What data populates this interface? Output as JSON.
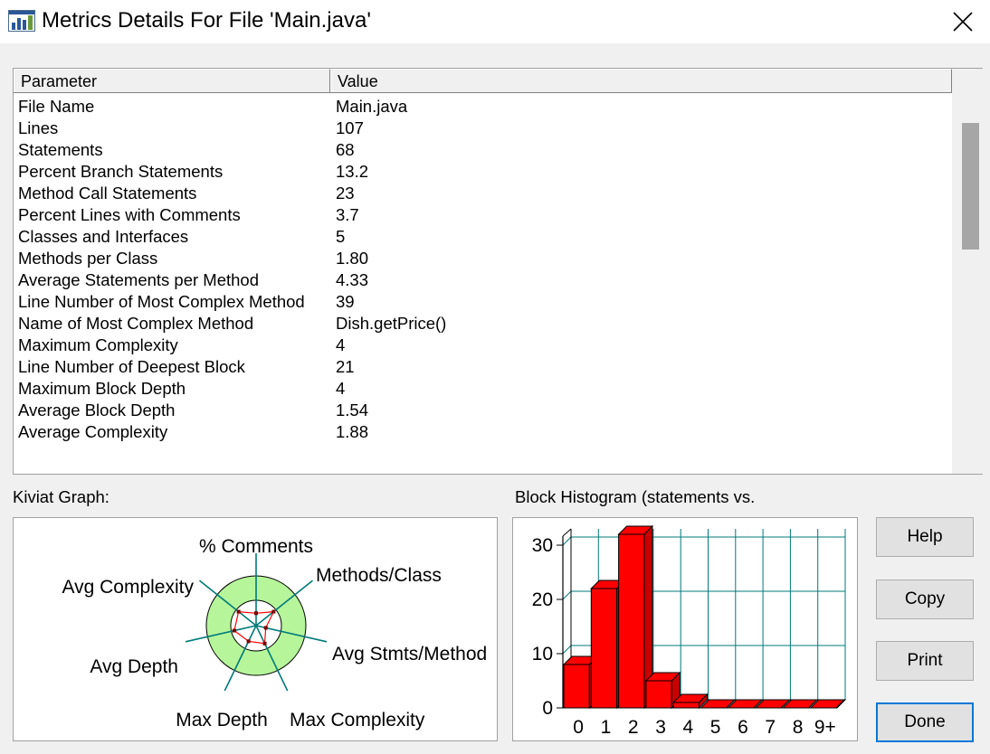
{
  "window": {
    "title": "Metrics Details For File 'Main.java'"
  },
  "table": {
    "headers": {
      "parameter": "Parameter",
      "value": "Value"
    },
    "rows": [
      {
        "param": "File Name",
        "value": "Main.java"
      },
      {
        "param": "Lines",
        "value": "107"
      },
      {
        "param": "Statements",
        "value": "68"
      },
      {
        "param": "Percent Branch Statements",
        "value": "13.2"
      },
      {
        "param": "Method Call Statements",
        "value": "23"
      },
      {
        "param": "Percent Lines with Comments",
        "value": "3.7"
      },
      {
        "param": "Classes and Interfaces",
        "value": "5"
      },
      {
        "param": "Methods per Class",
        "value": "1.80"
      },
      {
        "param": "Average Statements per Method",
        "value": "4.33"
      },
      {
        "param": "Line Number of Most Complex Method",
        "value": "39"
      },
      {
        "param": "Name of Most Complex Method",
        "value": "Dish.getPrice()"
      },
      {
        "param": "Maximum Complexity",
        "value": "4"
      },
      {
        "param": "Line Number of Deepest Block",
        "value": "21"
      },
      {
        "param": "Maximum Block Depth",
        "value": "4"
      },
      {
        "param": "Average Block Depth",
        "value": "1.54"
      },
      {
        "param": "Average Complexity",
        "value": "1.88"
      }
    ]
  },
  "kiviat": {
    "label": "Kiviat Graph:",
    "axes": [
      "% Comments",
      "Methods/Class",
      "Avg Stmts/Method",
      "Max Complexity",
      "Max Depth",
      "Avg Depth",
      "Avg Complexity"
    ],
    "colors": {
      "band": "#b6f59a",
      "spoke": "#007a7a",
      "trace": "#ff0000"
    }
  },
  "histogram": {
    "label": "Block Histogram (statements vs.",
    "colors": {
      "bar": "#ff0000",
      "grid": "#007a7a"
    }
  },
  "buttons": {
    "help": "Help",
    "copy": "Copy",
    "print": "Print",
    "done": "Done"
  },
  "chart_data": [
    {
      "type": "radar",
      "axes": [
        "% Comments",
        "Methods/Class",
        "Avg Stmts/Method",
        "Max Complexity",
        "Max Depth",
        "Avg Depth",
        "Avg Complexity"
      ],
      "values": [
        0.25,
        0.45,
        0.2,
        0.4,
        0.35,
        0.45,
        0.45
      ]
    },
    {
      "type": "bar",
      "categories": [
        "0",
        "1",
        "2",
        "3",
        "4",
        "5",
        "6",
        "7",
        "8",
        "9+"
      ],
      "values": [
        8,
        22,
        32,
        5,
        1,
        0,
        0,
        0,
        0,
        0
      ],
      "ylim": [
        0,
        32
      ],
      "yticks": [
        "0",
        "10",
        "20",
        "30"
      ],
      "grid": true
    }
  ]
}
